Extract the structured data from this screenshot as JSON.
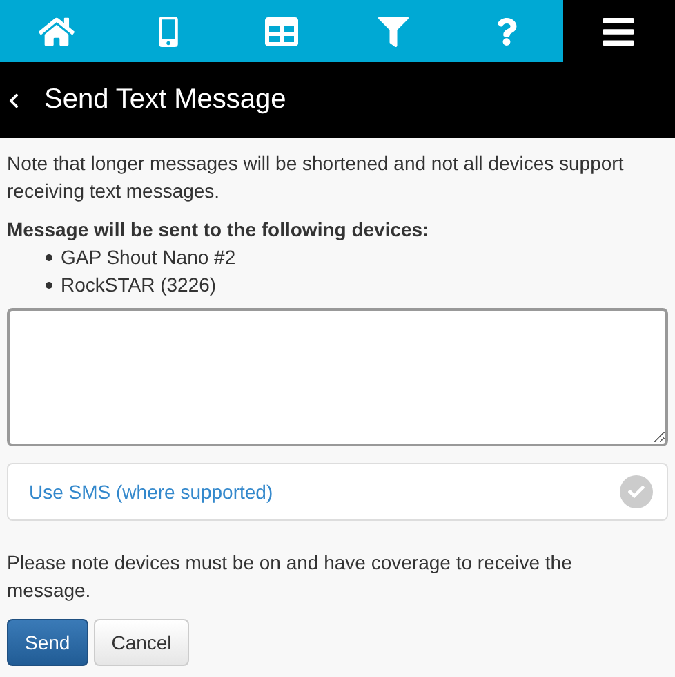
{
  "nav_tabs": [
    {
      "kind": "home",
      "selected": false
    },
    {
      "kind": "phone",
      "selected": false
    },
    {
      "kind": "grid",
      "selected": false
    },
    {
      "kind": "filter",
      "selected": false
    },
    {
      "kind": "help",
      "selected": false
    },
    {
      "kind": "menu",
      "selected": true
    }
  ],
  "header": {
    "title": "Send Text Message"
  },
  "intro": "Note that longer messages will be shortened and not all devices support receiving text messages.",
  "recipients_heading": "Message will be sent to the following devices:",
  "recipients": [
    "GAP Shout Nano #2",
    "RockSTAR (3226)"
  ],
  "sms_toggle": {
    "label": "Use SMS (where supported)",
    "checked": false
  },
  "coverage_note": "Please note devices must be on and have coverage to receive the message.",
  "buttons": [
    {
      "label": "Send",
      "kind": "primary"
    },
    {
      "label": "Cancel",
      "kind": "default"
    }
  ]
}
